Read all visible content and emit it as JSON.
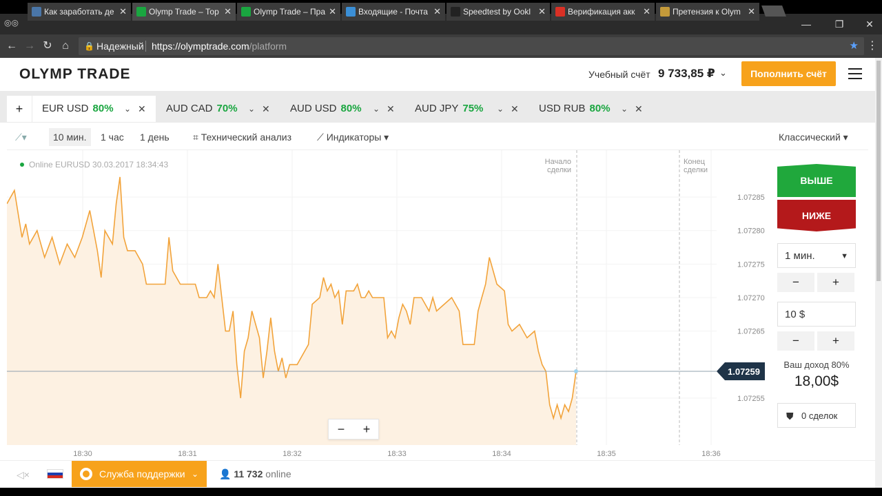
{
  "browser": {
    "tabs": [
      {
        "label": "Как заработать де",
        "favicon_color": "#4a76a8"
      },
      {
        "label": "Olymp Trade – Тор",
        "favicon_color": "#1aa640"
      },
      {
        "label": "Olymp Trade – Пра",
        "favicon_color": "#1aa640"
      },
      {
        "label": "Входящие - Почта",
        "favicon_color": "#3b8fd6"
      },
      {
        "label": "Speedtest by Ookl",
        "favicon_color": "#222222"
      },
      {
        "label": "Верификация акк",
        "favicon_color": "#d93025"
      },
      {
        "label": "Претензия к Olym",
        "favicon_color": "#c49a3a"
      }
    ],
    "secure_label": "Надежный",
    "url_host": "https://olymptrade.com",
    "url_path": "/platform",
    "win_min": "—",
    "win_restore": "❐",
    "win_close": "✕"
  },
  "header": {
    "logo": "OLYMP TRADE",
    "account_label": "Учебный счёт",
    "balance": "9 733,85 ₽",
    "deposit_label": "Пополнить счёт"
  },
  "assets": [
    {
      "name": "EUR USD",
      "pct": "80%",
      "active": true
    },
    {
      "name": "AUD CAD",
      "pct": "70%",
      "active": false
    },
    {
      "name": "AUD USD",
      "pct": "80%",
      "active": false
    },
    {
      "name": "AUD JPY",
      "pct": "75%",
      "active": false
    },
    {
      "name": "USD RUB",
      "pct": "80%",
      "active": false
    }
  ],
  "toolbar": {
    "timeframes": [
      "10 мин.",
      "1 час",
      "1 день"
    ],
    "tech_analysis": "Технический анализ",
    "indicators": "Индикаторы",
    "view_mode": "Классический"
  },
  "chart_data": {
    "type": "area",
    "status": "Online EURUSD 30.03.2017 18:34:43",
    "x_ticks": [
      "18:30",
      "18:31",
      "18:32",
      "18:33",
      "18:34",
      "18:35",
      "18:36"
    ],
    "y_ticks": [
      "1.07285",
      "1.07280",
      "1.07275",
      "1.07270",
      "1.07265",
      "1.07255"
    ],
    "ylim": [
      1.07248,
      1.07292
    ],
    "current_price": "1.07259",
    "start_marker": "Начало сделки",
    "end_marker": "Конец сделки",
    "zoom_minus": "−",
    "zoom_plus": "+",
    "line_color": "#f2a33a",
    "fill_color": "#fdf1e2",
    "series": [
      [
        0,
        1.07284
      ],
      [
        2,
        1.07286
      ],
      [
        4,
        1.07279
      ],
      [
        5,
        1.07281
      ],
      [
        6,
        1.07278
      ],
      [
        8,
        1.0728
      ],
      [
        10,
        1.07276
      ],
      [
        12,
        1.07279
      ],
      [
        14,
        1.07275
      ],
      [
        16,
        1.07278
      ],
      [
        18,
        1.07276
      ],
      [
        20,
        1.07279
      ],
      [
        22,
        1.07283
      ],
      [
        24,
        1.07277
      ],
      [
        25,
        1.07273
      ],
      [
        26,
        1.0728
      ],
      [
        28,
        1.07278
      ],
      [
        29,
        1.07284
      ],
      [
        30,
        1.07288
      ],
      [
        31,
        1.07279
      ],
      [
        32,
        1.07277
      ],
      [
        34,
        1.07277
      ],
      [
        36,
        1.07275
      ],
      [
        37,
        1.07272
      ],
      [
        40,
        1.07272
      ],
      [
        42,
        1.07272
      ],
      [
        43,
        1.07279
      ],
      [
        44,
        1.07274
      ],
      [
        46,
        1.07272
      ],
      [
        50,
        1.07272
      ],
      [
        51,
        1.0727
      ],
      [
        53,
        1.0727
      ],
      [
        54,
        1.07271
      ],
      [
        55,
        1.0727
      ],
      [
        56,
        1.07275
      ],
      [
        57,
        1.0727
      ],
      [
        58,
        1.07265
      ],
      [
        59,
        1.07265
      ],
      [
        60,
        1.07268
      ],
      [
        61,
        1.0726
      ],
      [
        62,
        1.07255
      ],
      [
        63,
        1.07262
      ],
      [
        64,
        1.07264
      ],
      [
        65,
        1.07268
      ],
      [
        66,
        1.07266
      ],
      [
        67,
        1.07264
      ],
      [
        68,
        1.07258
      ],
      [
        69,
        1.07262
      ],
      [
        70,
        1.07267
      ],
      [
        71,
        1.07262
      ],
      [
        72,
        1.07259
      ],
      [
        73,
        1.07261
      ],
      [
        74,
        1.07258
      ],
      [
        75,
        1.0726
      ],
      [
        77,
        1.0726
      ],
      [
        80,
        1.07263
      ],
      [
        81,
        1.07269
      ],
      [
        83,
        1.0727
      ],
      [
        84,
        1.07273
      ],
      [
        85,
        1.07271
      ],
      [
        86,
        1.07272
      ],
      [
        87,
        1.0727
      ],
      [
        88,
        1.07271
      ],
      [
        89,
        1.07266
      ],
      [
        90,
        1.07271
      ],
      [
        92,
        1.07271
      ],
      [
        93,
        1.07272
      ],
      [
        94,
        1.0727
      ],
      [
        95,
        1.0727
      ],
      [
        96,
        1.07271
      ],
      [
        97,
        1.0727
      ],
      [
        100,
        1.0727
      ],
      [
        101,
        1.07264
      ],
      [
        102,
        1.07265
      ],
      [
        103,
        1.07264
      ],
      [
        104,
        1.07267
      ],
      [
        105,
        1.07269
      ],
      [
        106,
        1.07268
      ],
      [
        107,
        1.07266
      ],
      [
        108,
        1.0727
      ],
      [
        110,
        1.0727
      ],
      [
        112,
        1.07268
      ],
      [
        113,
        1.0727
      ],
      [
        114,
        1.07268
      ],
      [
        118,
        1.0727
      ],
      [
        120,
        1.07268
      ],
      [
        121,
        1.07263
      ],
      [
        124,
        1.07263
      ],
      [
        125,
        1.07268
      ],
      [
        126,
        1.0727
      ],
      [
        127,
        1.07272
      ],
      [
        128,
        1.07276
      ],
      [
        129,
        1.07274
      ],
      [
        130,
        1.07272
      ],
      [
        132,
        1.07271
      ],
      [
        133,
        1.07266
      ],
      [
        134,
        1.07265
      ],
      [
        136,
        1.07266
      ],
      [
        138,
        1.07264
      ],
      [
        140,
        1.07265
      ],
      [
        141,
        1.07262
      ],
      [
        142,
        1.0726
      ],
      [
        143,
        1.07259
      ],
      [
        144,
        1.07254
      ],
      [
        145,
        1.07252
      ],
      [
        146,
        1.07254
      ],
      [
        147,
        1.07252
      ],
      [
        148,
        1.07254
      ],
      [
        149,
        1.07253
      ],
      [
        150,
        1.07255
      ],
      [
        151,
        1.07259
      ]
    ]
  },
  "trade_panel": {
    "up_label": "ВЫШЕ",
    "down_label": "НИЖЕ",
    "duration": "1 мин.",
    "amount": "10 $",
    "stepper_minus": "−",
    "stepper_plus": "+",
    "income_label": "Ваш доход 80%",
    "income_value": "18,00$",
    "deals_label": "0 сделок"
  },
  "footer": {
    "support_label": "Служба поддержки",
    "online_count": "11 732",
    "online_label": "online"
  }
}
